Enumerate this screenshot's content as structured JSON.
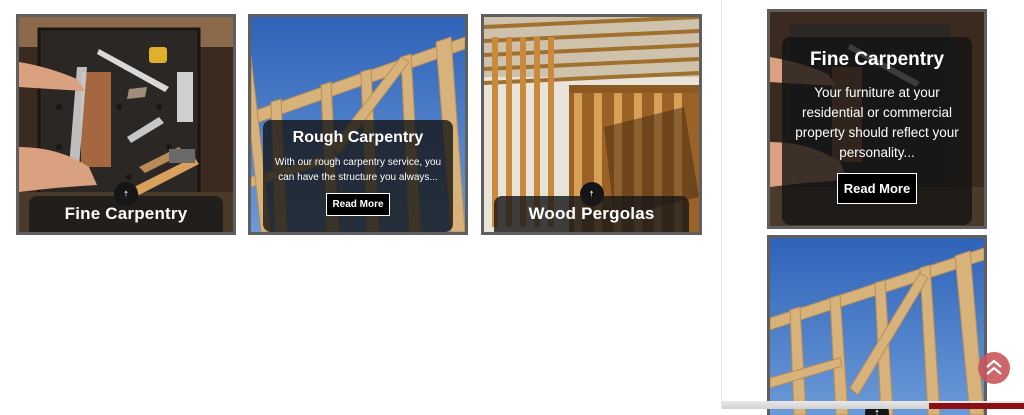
{
  "cards": [
    {
      "title": "Fine Carpentry"
    },
    {
      "title": "Rough Carpentry",
      "description": "With our rough carpentry service, you can have the structure you always...",
      "button_label": "Read More"
    },
    {
      "title": "Wood Pergolas"
    }
  ],
  "expanded_card": {
    "title": "Fine Carpentry",
    "description": "Your furniture at your residential or commercial property should reflect your personality...",
    "button_label": "Read More"
  },
  "icons": {
    "expand": "arrow-up-icon",
    "scroll_top": "chevron-up-icon"
  },
  "colors": {
    "card_border": "#5f5f5f",
    "overlay_bg": "#191919",
    "scroll_top_bg": "#c8575c",
    "accent_red": "#8b0f15"
  }
}
